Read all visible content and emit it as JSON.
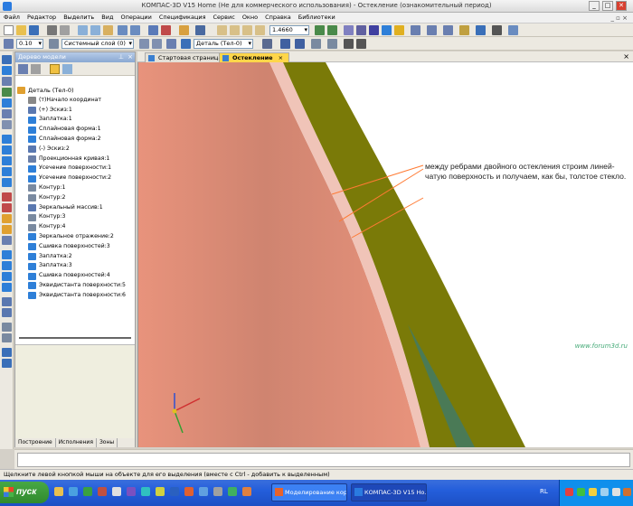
{
  "window": {
    "title": "КОМПАС-3D V15 Home (Не для коммерческого использования) - Остекление (ознакомительный период)",
    "controls": [
      "_",
      "□",
      "✕"
    ]
  },
  "menu": {
    "items": [
      "Файл",
      "Редактор",
      "Выделить",
      "Вид",
      "Операции",
      "Спецификация",
      "Сервис",
      "Окно",
      "Справка",
      "Библиотеки"
    ]
  },
  "toolbar": {
    "zoom_value": "1.4660",
    "line_width": "0.10",
    "layer": "Системный слой (0)",
    "part": "Деталь (Тел-0)"
  },
  "tree_panel": {
    "header": "Дерево модели",
    "root": "Деталь (Тел-0)",
    "items": [
      {
        "label": "(т)Начало координат",
        "icon": "origin-icon",
        "color": "#888888"
      },
      {
        "label": "(+) Эскиз:1",
        "icon": "sketch-icon",
        "color": "#5a78b0"
      },
      {
        "label": "Заплатка:1",
        "icon": "patch-icon",
        "color": "#2e7fd8"
      },
      {
        "label": "Сплайновая форма:1",
        "icon": "spline-icon",
        "color": "#2e7fd8"
      },
      {
        "label": "Сплайновая форма:2",
        "icon": "spline-icon",
        "color": "#2e7fd8"
      },
      {
        "label": "(-) Эскиз:2",
        "icon": "sketch-icon",
        "color": "#5a78b0"
      },
      {
        "label": "Проекционная кривая:1",
        "icon": "curve-icon",
        "color": "#6b7fa8"
      },
      {
        "label": "Усечение поверхности:1",
        "icon": "trim-icon",
        "color": "#2e7fd8"
      },
      {
        "label": "Усечение поверхности:2",
        "icon": "trim-icon",
        "color": "#2e7fd8"
      },
      {
        "label": "Контур:1",
        "icon": "contour-icon",
        "color": "#7a8aa0"
      },
      {
        "label": "Контур:2",
        "icon": "contour-icon",
        "color": "#7a8aa0"
      },
      {
        "label": "Зеркальный массив:1",
        "icon": "mirror-array-icon",
        "color": "#5a78b0"
      },
      {
        "label": "Контур:3",
        "icon": "contour-icon",
        "color": "#7a8aa0"
      },
      {
        "label": "Контур:4",
        "icon": "contour-icon",
        "color": "#7a8aa0"
      },
      {
        "label": "Зеркальное отражение:2",
        "icon": "mirror-icon",
        "color": "#2e7fd8"
      },
      {
        "label": "Сшивка поверхностей:3",
        "icon": "stitch-icon",
        "color": "#2e7fd8"
      },
      {
        "label": "Заплатка:2",
        "icon": "patch-icon",
        "color": "#2e7fd8"
      },
      {
        "label": "Заплатка:3",
        "icon": "patch-icon",
        "color": "#2e7fd8"
      },
      {
        "label": "Сшивка поверхностей:4",
        "icon": "stitch-icon",
        "color": "#2e7fd8"
      },
      {
        "label": "Эквидистанта поверхности:5",
        "icon": "offset-icon",
        "color": "#2e7fd8"
      },
      {
        "label": "Эквидистанта поверхности:6",
        "icon": "offset-icon",
        "color": "#2e7fd8"
      }
    ],
    "tabs": [
      "Построение",
      "Исполнения",
      "Зоны"
    ]
  },
  "doc_tabs": [
    {
      "label": "Стартовая страница",
      "active": false
    },
    {
      "label": "Остекление",
      "active": true
    }
  ],
  "canvas": {
    "annotation": "между ребрами двойного остекления строим линей-чатую поверхность и получаем, как бы, толстое стекло.",
    "watermark": "www.forum3d.ru",
    "colors": {
      "background": "#ffffff",
      "glass_salmon": "#e8937c",
      "gap_pink": "#f0c4b8",
      "olive": "#7a7a08",
      "arrow": "#ff7a33"
    }
  },
  "statusbar": {
    "text": "Щелкните левой кнопкой мыши на объекте для его выделения (вместе с Ctrl - добавить к выделенным)"
  },
  "taskbar": {
    "start_label": "пуск",
    "buttons": [
      {
        "label": "Моделирование кор...",
        "pressed": false
      },
      {
        "label": "КОМПАС-3D V15 Ho...",
        "pressed": true
      }
    ],
    "language": "RL"
  }
}
